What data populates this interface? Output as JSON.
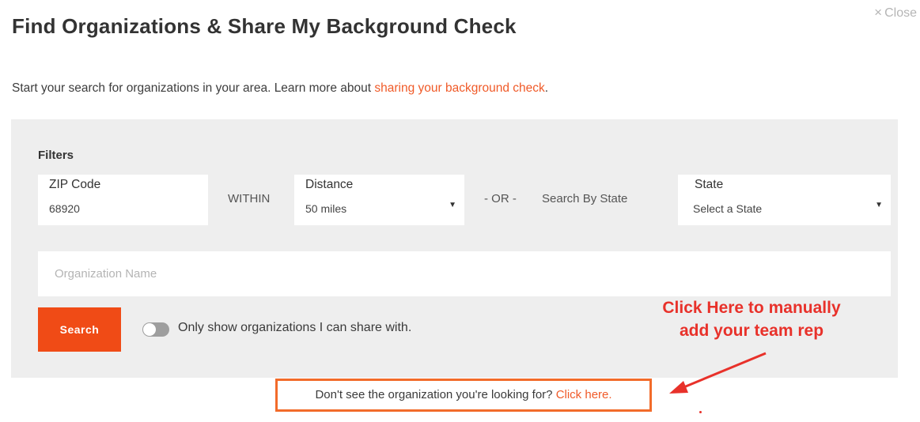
{
  "dialog": {
    "close_label": "Close",
    "title": "Find Organizations & Share My Background Check",
    "intro_text": "Start your search for organizations in your area. Learn more about ",
    "intro_link": "sharing your background check",
    "intro_end": "."
  },
  "filters": {
    "heading": "Filters",
    "zip": {
      "label": "ZIP Code",
      "value": "68920"
    },
    "within_text": "WITHIN",
    "distance": {
      "label": "Distance",
      "value": "50 miles"
    },
    "or_text": "- OR -",
    "search_by_state_text": "Search By State",
    "state": {
      "label": "State",
      "value": "Select a State"
    },
    "org_name_placeholder": "Organization Name",
    "search_button": "Search",
    "toggle_label": "Only show organizations I can share with.",
    "toggle_on": false
  },
  "annotation": {
    "line1": "Click Here to manually",
    "line2": "add your team rep",
    "color": "#e8312a"
  },
  "footer": {
    "prompt": "Don't see the organization you're looking for? ",
    "link": "Click here."
  },
  "icons": {
    "close": "close-icon",
    "caret": "caret-down-icon",
    "arrow": "annotation-arrow-icon"
  },
  "colors": {
    "accent": "#f04b16",
    "link": "#f05a28",
    "panel_bg": "#eeeeee"
  }
}
